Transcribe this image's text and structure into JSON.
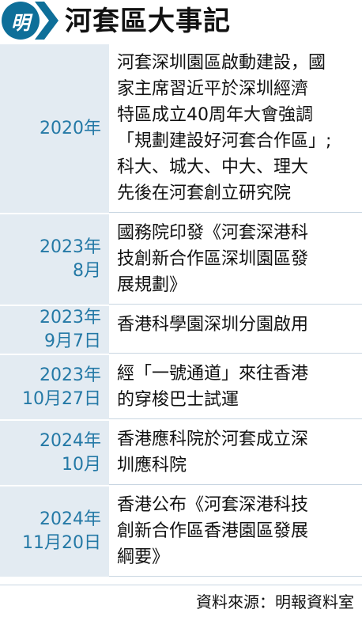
{
  "header": {
    "logo_char": "明",
    "title": "河套區大事記",
    "accent": "#0e6f99"
  },
  "rows": [
    {
      "date_lines": [
        "2020年"
      ],
      "desc_lines": [
        "河套深圳園區啟動建設，國",
        "家主席習近平於深圳經濟",
        "特區成立40周年大會強調",
        "「規劃建設好河套合作區」;",
        "科大、城大、中大、理大",
        "先後在河套創立研究院"
      ]
    },
    {
      "date_lines": [
        "2023年",
        "8月"
      ],
      "desc_lines": [
        "國務院印發《河套深港科",
        "技創新合作區深圳園區發",
        "展規劃》"
      ]
    },
    {
      "date_lines": [
        "2023年",
        "9月7日"
      ],
      "desc_lines": [
        "香港科學園深圳分園啟用"
      ]
    },
    {
      "date_lines": [
        "2023年",
        "10月27日"
      ],
      "desc_lines": [
        "經「一號通道」來往香港",
        "的穿梭巴士試運"
      ]
    },
    {
      "date_lines": [
        "2024年",
        "10月"
      ],
      "desc_lines": [
        "香港應科院於河套成立深",
        "圳應科院"
      ]
    },
    {
      "date_lines": [
        "2024年",
        "11月20日"
      ],
      "desc_lines": [
        "香港公布《河套深港科技",
        "創新合作區香港園區發展",
        "綱要》"
      ]
    }
  ],
  "footer": {
    "source": "資料來源：明報資料室"
  }
}
